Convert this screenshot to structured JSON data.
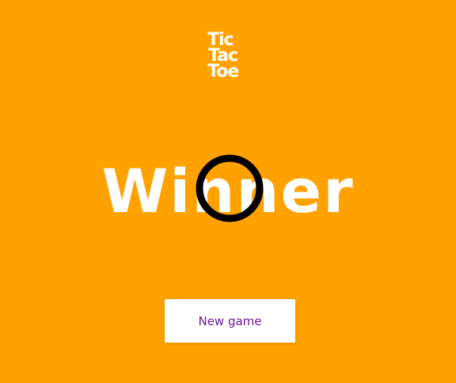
{
  "logo": {
    "line1": "Tic",
    "line2": "Tac",
    "line3": "Toe"
  },
  "result": {
    "label": "Winner",
    "winning_mark": "O",
    "mark_icon": "circle-o-icon",
    "mark_color": "#000000"
  },
  "actions": {
    "new_game_label": "New game"
  },
  "colors": {
    "background": "#FFA200",
    "text": "#FFFFFF",
    "button_background": "#FFFFFF",
    "button_text": "#6A1B9A"
  }
}
